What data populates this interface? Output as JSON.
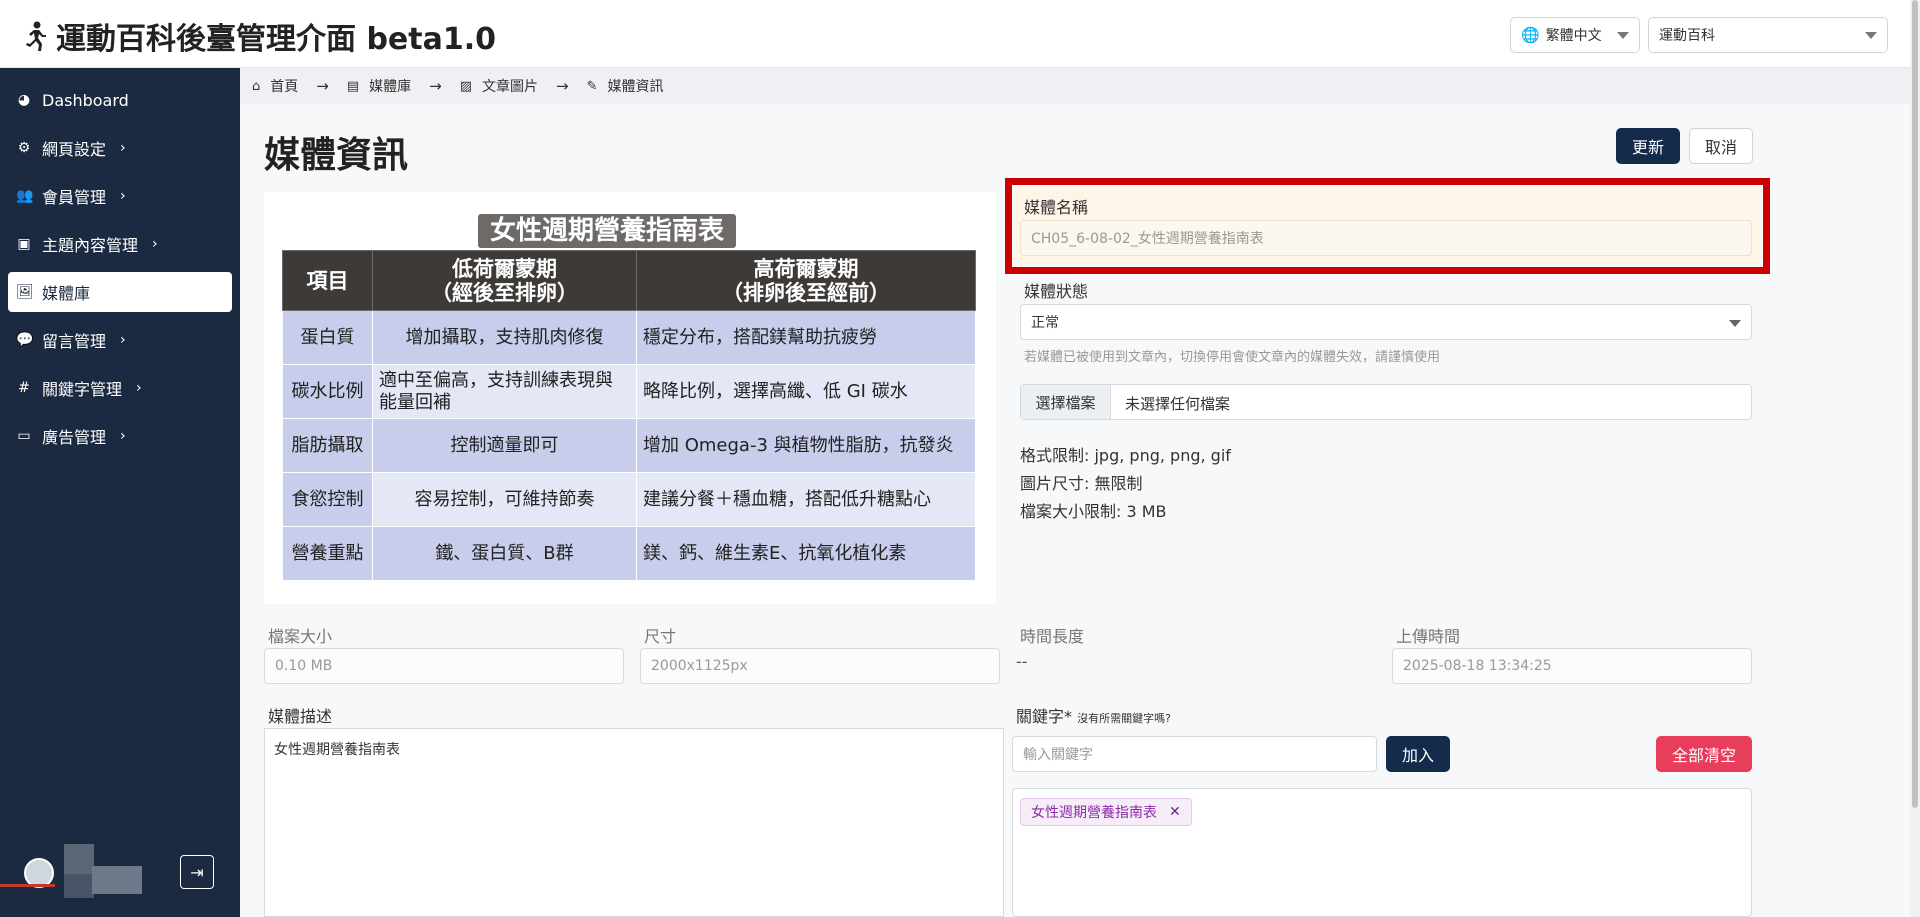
{
  "header": {
    "title": "運動百科後臺管理介面 beta1.0",
    "language": "繁體中文",
    "site": "運動百科"
  },
  "sidebar": {
    "items": [
      {
        "label": "Dashboard"
      },
      {
        "label": "網頁設定"
      },
      {
        "label": "會員管理"
      },
      {
        "label": "主題內容管理"
      },
      {
        "label": "媒體庫"
      },
      {
        "label": "留言管理"
      },
      {
        "label": "關鍵字管理"
      },
      {
        "label": "廣告管理"
      }
    ]
  },
  "breadcrumb": [
    "首頁",
    "媒體庫",
    "文章圖片",
    "媒體資訊"
  ],
  "page": {
    "title": "媒體資訊",
    "update_label": "更新",
    "cancel_label": "取消"
  },
  "image": {
    "title": "女性週期營養指南表",
    "headers": [
      "項目",
      "低荷爾蒙期\n（經後至排卵）",
      "高荷爾蒙期\n（排卵後至經前）"
    ],
    "rows": [
      [
        "蛋白質",
        "增加攝取，支持肌肉修復",
        "穩定分布，搭配鎂幫助抗疲勞"
      ],
      [
        "碳水比例",
        "適中至偏高，支持訓練表現與能量回補",
        "略降比例，選擇高纖、低 GI 碳水"
      ],
      [
        "脂肪攝取",
        "控制適量即可",
        "增加 Omega-3 與植物性脂肪，抗發炎"
      ],
      [
        "食慾控制",
        "容易控制，可維持節奏",
        "建議分餐＋穩血糖，搭配低升糖點心"
      ],
      [
        "營養重點",
        "鐵、蛋白質、B群",
        "鎂、鈣、維生素E、抗氧化植化素"
      ]
    ]
  },
  "form": {
    "name_label": "媒體名稱",
    "name_value": "CH05_6-08-02_女性週期營養指南表",
    "status_label": "媒體狀態",
    "status_value": "正常",
    "status_hint": "若媒體已被使用到文章內，切換停用會使文章內的媒體失效，請謹慎使用",
    "file_button": "選擇檔案",
    "file_text": "未選擇任何檔案",
    "format_limit": "格式限制: jpg, png, png, gif",
    "image_size": "圖片尺寸: 無限制",
    "file_size_limit": "檔案大小限制: 3 MB",
    "filesize_label": "檔案大小",
    "filesize_value": "0.10 MB",
    "dimension_label": "尺寸",
    "dimension_value": "2000x1125px",
    "duration_label": "時間長度",
    "duration_value": "--",
    "upload_label": "上傳時間",
    "upload_value": "2025-08-18 13:34:25",
    "desc_label": "媒體描述",
    "desc_value": "女性週期營養指南表",
    "keyword_label": "關鍵字*",
    "keyword_hint": "沒有所需關鍵字嗎?",
    "keyword_placeholder": "輸入關鍵字",
    "add_label": "加入",
    "clear_label": "全部清空",
    "tags": [
      "女性週期營養指南表"
    ]
  },
  "colors": {
    "sidebar_bg": "#1b2a41",
    "primary": "#142b4c",
    "danger": "#e83e5c",
    "highlight_border": "#cc0000"
  }
}
